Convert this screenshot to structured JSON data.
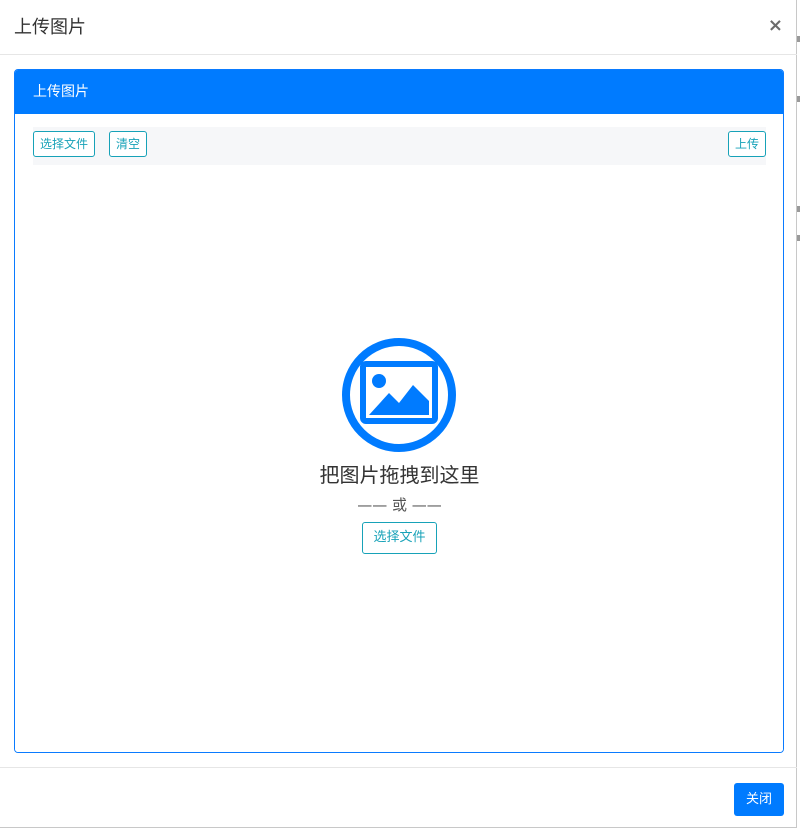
{
  "modal": {
    "title": "上传图片",
    "close_glyph": "×",
    "close_icon": "close-icon"
  },
  "card": {
    "header_title": "上传图片"
  },
  "toolbar": {
    "choose_file_label": "选择文件",
    "clear_label": "清空",
    "upload_label": "上传"
  },
  "drop_zone": {
    "icon": "image-icon",
    "drop_text": "把图片拖拽到这里",
    "or_text": "—— 或 ——",
    "choose_file_label": "选择文件"
  },
  "footer": {
    "close_label": "关闭"
  },
  "colors": {
    "primary": "#007bff",
    "info_outline": "#17a2b8",
    "panel_bg": "#f6f7f9"
  }
}
